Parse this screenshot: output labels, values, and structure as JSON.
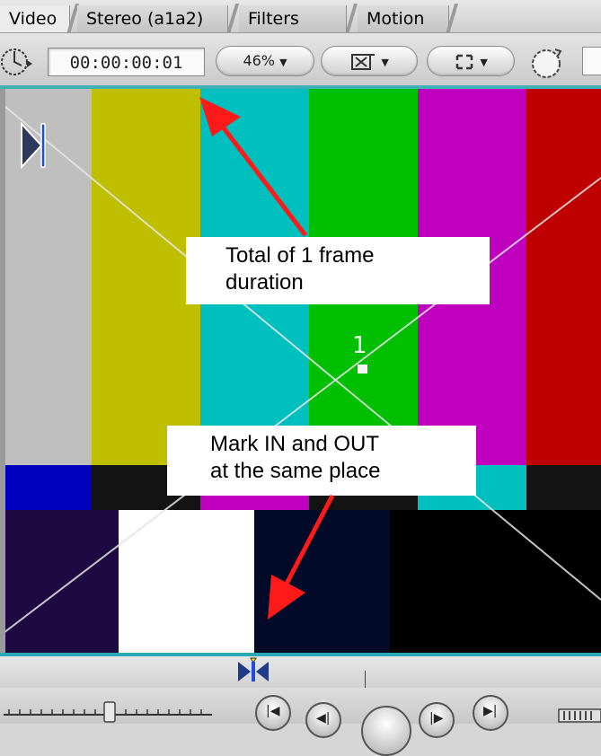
{
  "tabs": [
    {
      "label": "Video",
      "active": true
    },
    {
      "label": "Stereo (a1a2)",
      "active": false
    },
    {
      "label": "Filters",
      "active": false
    },
    {
      "label": "Motion",
      "active": false
    }
  ],
  "toolbar": {
    "timecode": "00:00:00:01",
    "zoom": "46%"
  },
  "canvas": {
    "frame_number": "1",
    "callouts": {
      "top": {
        "line1": "Total of 1 frame",
        "line2": "duration"
      },
      "bottom": {
        "line1": "Mark IN and OUT",
        "line2": "at the same place"
      }
    },
    "arrow_color": "#ff1a1a",
    "bar_colors_top": [
      "#bfbfbf",
      "#bfbf00",
      "#00bfbf",
      "#00bf00",
      "#bf00bf",
      "#bf0000"
    ]
  },
  "icons": {
    "timecode": "stopwatch-icon",
    "zoom_menu": "chevron-down-icon",
    "view_menu": "overlay-icon",
    "display_menu": "display-mode-icon",
    "playhead_sync": "dial-icon",
    "in_point": "in-point-marker-icon",
    "in_out_marker": "in-out-marker-icon"
  }
}
